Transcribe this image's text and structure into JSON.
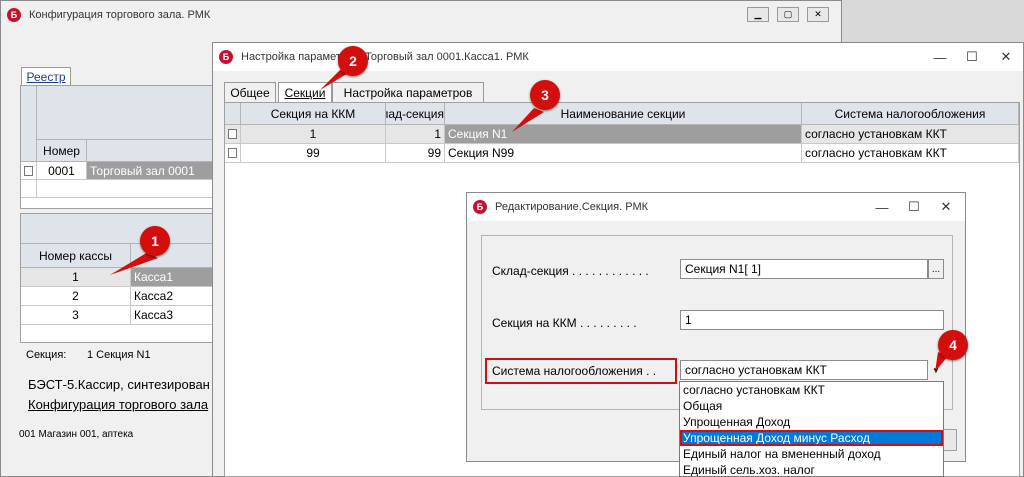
{
  "main_window": {
    "title": "Конфигурация торгового зала. РМК",
    "app_icon": "Б",
    "tab": "Реестр",
    "header_number": "Номер",
    "row": {
      "number": "0001",
      "name": "Торговый зал 0001"
    },
    "kassa_header": "Номер кассы",
    "kassa_rows": [
      {
        "num": "1",
        "name": "Касса1"
      },
      {
        "num": "2",
        "name": "Касса2"
      },
      {
        "num": "3",
        "name": "Касса3"
      }
    ],
    "section_label": "Секция:",
    "section_value": "1 Секция N1",
    "info_line": "БЭСТ-5.Кассир, синтезирован",
    "link_line": "Конфигурация торгового зала",
    "status": "001 Магазин 001, аптека"
  },
  "params_window": {
    "title": "Настройка параметров. Торговый зал 0001.Касса1. РМК",
    "tabs": [
      "Общее",
      "Секции",
      "Настройка параметров"
    ],
    "columns": [
      "Секция на ККМ",
      "Склад-секция",
      "Наименование секции",
      "Система налогообложения"
    ],
    "rows": [
      {
        "kkm": "1",
        "sklad": "1",
        "name": "Секция N1",
        "tax": "согласно установкам ККТ"
      },
      {
        "kkm": "99",
        "sklad": "99",
        "name": "Секция N99",
        "tax": "согласно установкам ККТ"
      }
    ]
  },
  "edit_dialog": {
    "title": "Редактирование.Секция. РМК",
    "sklad_label": "Склад-секция . . . . . . . . . . . .",
    "sklad_value": "Секция N1[      1]",
    "browse": "...",
    "kkm_label": "Секция на ККМ . . . . . . . . .",
    "kkm_value": "1",
    "tax_label": "Система налогообложения . .",
    "tax_value": "согласно установкам ККТ",
    "tax_options": [
      "согласно установкам ККТ",
      "Общая",
      "Упрощенная Доход",
      "Упрощенная Доход минус Расход",
      "Единый налог на вмененный доход",
      "Единый сель.хоз. налог"
    ]
  },
  "markers": [
    "1",
    "2",
    "3",
    "4"
  ],
  "colors": {
    "marker": "#d40d0d",
    "highlight_border": "#d40d0d",
    "dropdown_selected": "#0078d7",
    "row_selected": "#9e9e9e"
  }
}
